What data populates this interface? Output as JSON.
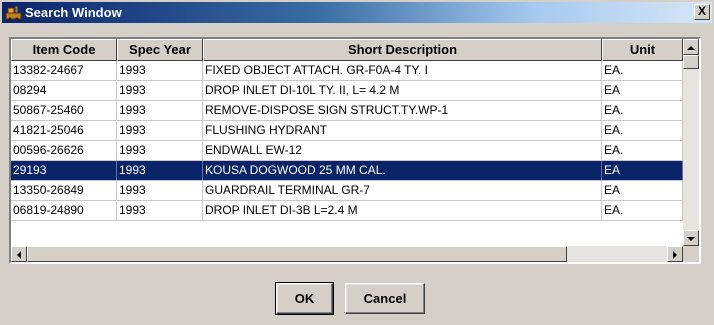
{
  "window": {
    "title": "Search Window",
    "close_label": "X"
  },
  "table": {
    "columns": [
      "Item Code",
      "Spec Year",
      "Short Description",
      "Unit"
    ],
    "rows": [
      {
        "code": "13382-24667",
        "year": "1993",
        "desc": "FIXED OBJECT ATTACH. GR-F0A-4 TY. I",
        "unit": "EA."
      },
      {
        "code": "08294",
        "year": "1993",
        "desc": "DROP INLET DI-10L TY. II, L= 4.2 M",
        "unit": "EA"
      },
      {
        "code": "50867-25460",
        "year": "1993",
        "desc": "REMOVE-DISPOSE SIGN STRUCT.TY.WP-1",
        "unit": "EA."
      },
      {
        "code": "41821-25046",
        "year": "1993",
        "desc": "FLUSHING HYDRANT",
        "unit": "EA."
      },
      {
        "code": "00596-26626",
        "year": "1993",
        "desc": "ENDWALL EW-12",
        "unit": "EA."
      },
      {
        "code": "29193",
        "year": "1993",
        "desc": "KOUSA DOGWOOD 25 MM CAL.",
        "unit": "EA",
        "selected": true
      },
      {
        "code": "13350-26849",
        "year": "1993",
        "desc": "GUARDRAIL TERMINAL GR-7",
        "unit": "EA"
      },
      {
        "code": "06819-24890",
        "year": "1993",
        "desc": "DROP INLET DI-3B L=2.4 M",
        "unit": "EA."
      }
    ]
  },
  "buttons": {
    "ok": "OK",
    "cancel": "Cancel"
  },
  "icons": {
    "title_icon": "app-icon",
    "scroll_up": "arrow-up-icon",
    "scroll_down": "arrow-down-icon",
    "scroll_left": "arrow-left-icon",
    "scroll_right": "arrow-right-icon"
  },
  "colors": {
    "titlebar_start": "#0a246a",
    "titlebar_end": "#d6e6f6",
    "selection": "#0a246a",
    "face": "#d4d0c8"
  }
}
